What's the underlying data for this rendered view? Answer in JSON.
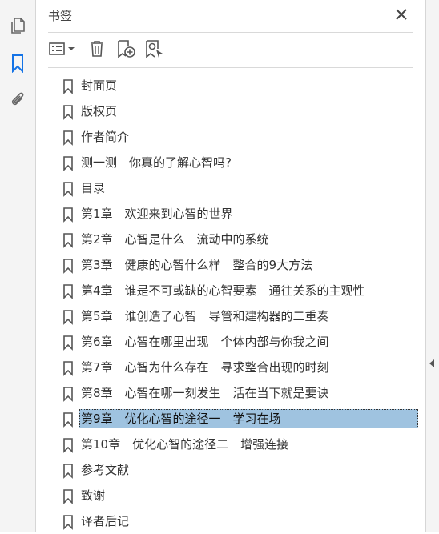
{
  "panel": {
    "title": "书签"
  },
  "left_nav": [
    "pages-icon",
    "bookmark-icon",
    "attachment-icon"
  ],
  "toolbar": {
    "options": "options-icon",
    "delete": "trash-icon",
    "add": "add-bookmark-icon",
    "find": "find-bookmark-icon"
  },
  "bookmarks": [
    "封面页",
    "版权页",
    "作者简介",
    "测一测　你真的了解心智吗?",
    "目录",
    "第1章　欢迎来到心智的世界",
    "第2章　心智是什么　流动中的系统",
    "第3章　健康的心智什么样　整合的9大方法",
    "第4章　谁是不可或缺的心智要素　通往关系的主观性",
    "第5章　谁创造了心智　导管和建构器的二重奏",
    "第6章　心智在哪里出现　个体内部与你我之间",
    "第7章　心智为什么存在　寻求整合出现的时刻",
    "第8章　心智在哪一刻发生　活在当下就是要诀",
    "第9章　优化心智的途径一　学习在场",
    "第10章　优化心智的途径二　增强连接",
    "参考文献",
    "致谢",
    "译者后记"
  ],
  "selected_index": 13,
  "colors": {
    "selection": "#9fc3e0",
    "active_nav": "#1473e6"
  }
}
